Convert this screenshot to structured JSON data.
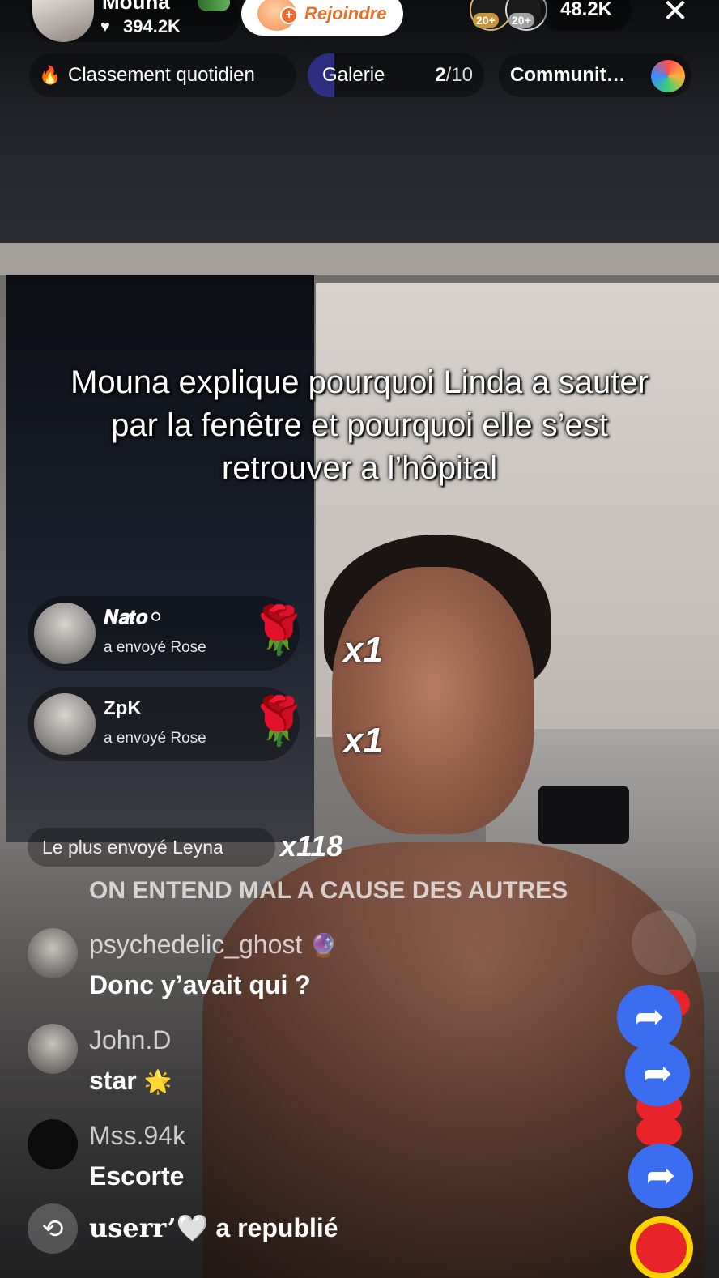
{
  "host": {
    "name": "Mouna",
    "likes": "394.2K",
    "join_label": "Rejoindre"
  },
  "viewers": {
    "badge_a": "20+",
    "badge_b": "20+",
    "count": "48.2K"
  },
  "nav": {
    "ranking": "Classement quotidien",
    "gallery_label": "Galerie",
    "gallery_current": 2,
    "gallery_total": 10,
    "gallery_current_label": "2",
    "gallery_total_label": "/10",
    "community": "Communit…"
  },
  "caption": "Mouna explique pourquoi Linda a sauter par la fenêtre et pourquoi elle s’est retrouver a l’hôpital",
  "gifts": [
    {
      "user": "𝑵𝒂𝒕𝒐⚪",
      "text": "a envoyé  Rose",
      "multiplier": "x1"
    },
    {
      "user": "ZpK",
      "text": "a envoyé  Rose",
      "multiplier": "x1"
    }
  ],
  "top_gifter": {
    "text": "Le plus envoyé Leyna",
    "multiplier": "x118"
  },
  "pinned": "ON ENTEND MAL A CAUSE DES AUTRES",
  "chat": [
    {
      "user": "psychedelic_ghost",
      "text": "Donc y’avait qui ?"
    },
    {
      "user": "John.D",
      "text": "star"
    },
    {
      "user": "Mss.94k",
      "text": "Escorte"
    }
  ],
  "repost": {
    "user": "userr’",
    "text": "a republié"
  },
  "icons": {
    "like": "heart-icon",
    "join": "join-plus-icon",
    "close": "close-icon",
    "ranking": "fire-icon",
    "share": "share-arrow-icon",
    "repost": "repost-icon",
    "gift": "rose-icon"
  },
  "colors": {
    "join_text": "#e8702a",
    "share": "#3b6df0",
    "gallery_progress": "#4646dc",
    "ranking_icon": "#ffb400"
  }
}
